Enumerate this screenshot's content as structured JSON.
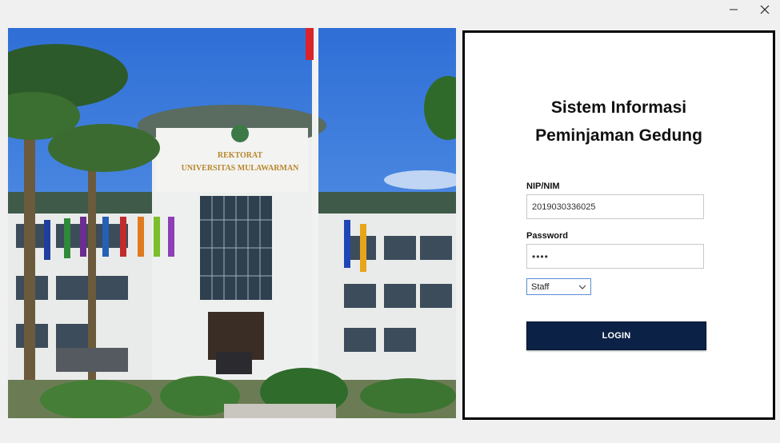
{
  "window": {
    "minimize_icon": "minimize-icon",
    "close_icon": "close-icon"
  },
  "photo": {
    "sign_line1": "REKTORAT",
    "sign_line2": "UNIVERSITAS MULAWARMAN"
  },
  "login": {
    "title_line1": "Sistem Informasi",
    "title_line2": "Peminjaman Gedung",
    "nip_label": "NIP/NIM",
    "nip_value": "2019030336025",
    "password_label": "Password",
    "password_value": "••••",
    "role_selected": "Staff",
    "button_label": "LOGIN"
  },
  "colors": {
    "login_button": "#0c2146",
    "panel_border": "#000000",
    "select_border": "#5b8ed6"
  }
}
